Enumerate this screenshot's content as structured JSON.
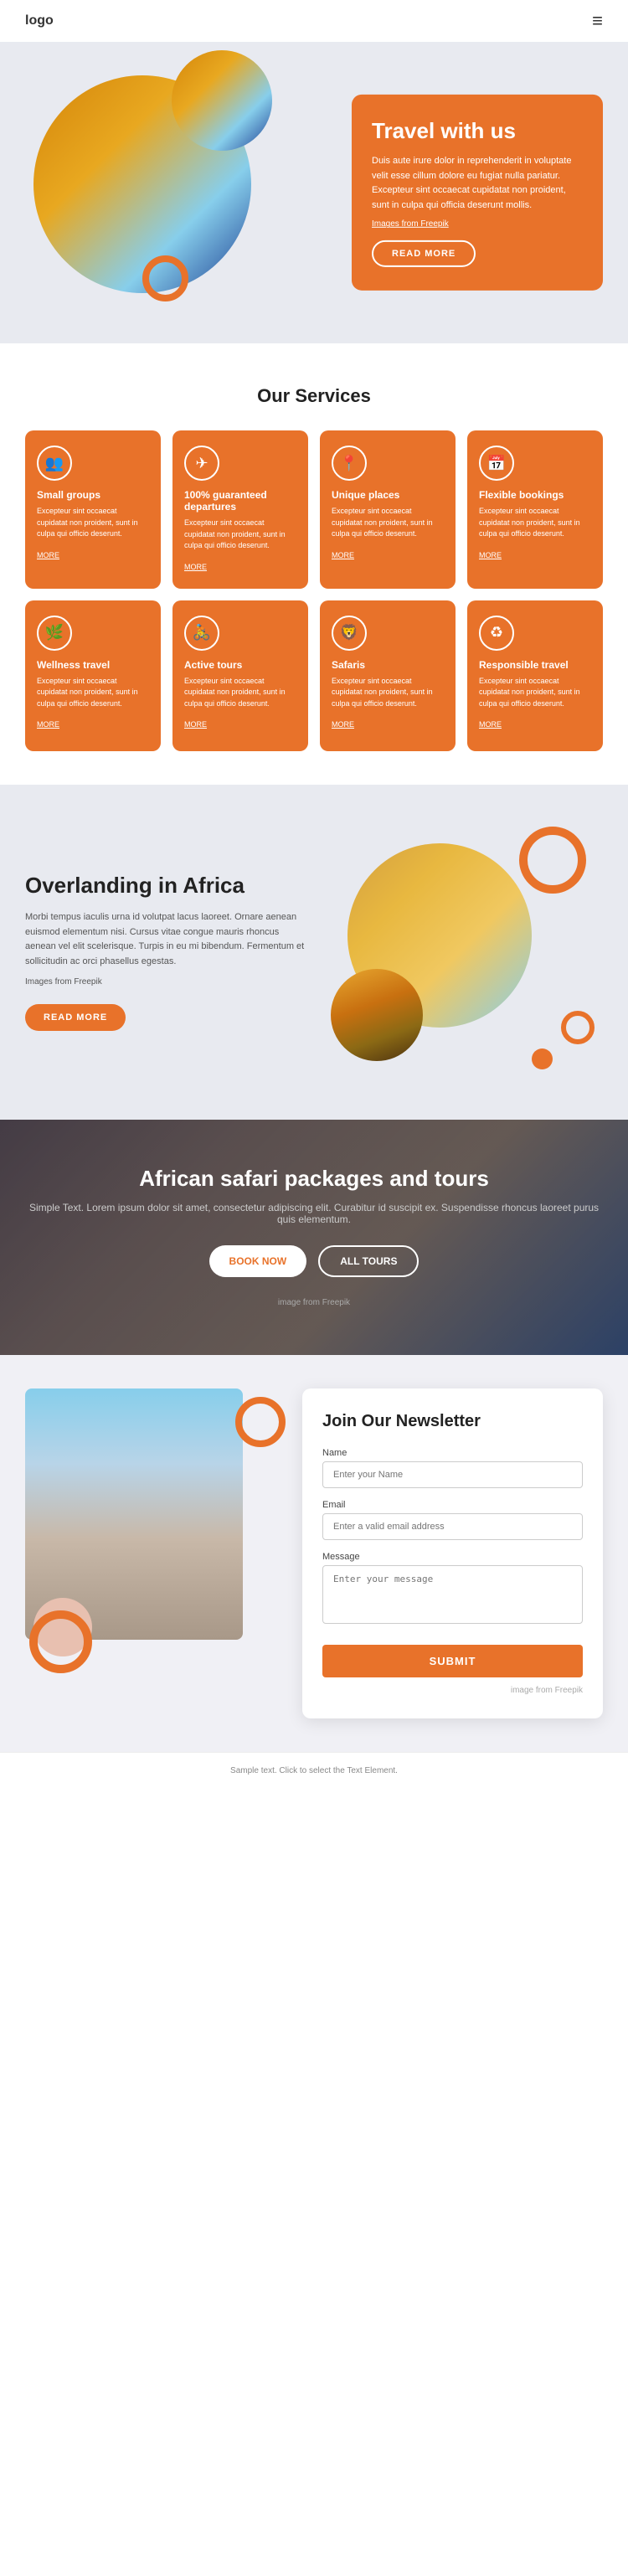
{
  "nav": {
    "logo": "logo",
    "hamburger_icon": "≡"
  },
  "hero": {
    "title": "Travel with us",
    "body": "Duis aute irure dolor in reprehenderit in voluptate velit esse cillum dolore eu fugiat nulla pariatur. Excepteur sint occaecat cupidatat non proident, sunt in culpa qui officia deserunt mollis.",
    "img_credit": "Images from Freepik",
    "read_more_btn": "READ MORE"
  },
  "services": {
    "heading": "Our Services",
    "cards": [
      {
        "icon": "👥",
        "title": "Small groups",
        "body": "Excepteur sint occaecat cupidatat non proident, sunt in culpa qui officio deserunt.",
        "link": "MORE"
      },
      {
        "icon": "✈",
        "title": "100% guaranteed departures",
        "body": "Excepteur sint occaecat cupidatat non proident, sunt in culpa qui officio deserunt.",
        "link": "MORE"
      },
      {
        "icon": "📍",
        "title": "Unique places",
        "body": "Excepteur sint occaecat cupidatat non proident, sunt in culpa qui officio deserunt.",
        "link": "MORE"
      },
      {
        "icon": "📅",
        "title": "Flexible bookings",
        "body": "Excepteur sint occaecat cupidatat non proident, sunt in culpa qui officio deserunt.",
        "link": "MORE"
      },
      {
        "icon": "🌿",
        "title": "Wellness travel",
        "body": "Excepteur sint occaecat cupidatat non proident, sunt in culpa qui officio deserunt.",
        "link": "MORE"
      },
      {
        "icon": "🚴",
        "title": "Active tours",
        "body": "Excepteur sint occaecat cupidatat non proident, sunt in culpa qui officio deserunt.",
        "link": "MORE"
      },
      {
        "icon": "🦁",
        "title": "Safaris",
        "body": "Excepteur sint occaecat cupidatat non proident, sunt in culpa qui officio deserunt.",
        "link": "MORE"
      },
      {
        "icon": "♻",
        "title": "Responsible travel",
        "body": "Excepteur sint occaecat cupidatat non proident, sunt in culpa qui officio deserunt.",
        "link": "MORE"
      }
    ]
  },
  "overlanding": {
    "title": "Overlanding in Africa",
    "body": "Morbi tempus iaculis urna id volutpat lacus laoreet. Ornare aenean euismod elementum nisi. Cursus vitae congue mauris rhoncus aenean vel elit scelerisque. Turpis in eu mi bibendum. Fermentum et sollicitudin ac orci phasellus egestas.",
    "img_credit": "Images from Freepik",
    "read_more_btn": "READ MORE"
  },
  "safari": {
    "title": "African safari packages and tours",
    "body": "Simple Text. Lorem ipsum dolor sit amet, consectetur adipiscing elit. Curabitur id suscipit ex. Suspendisse rhoncus laoreet purus quis elementum.",
    "book_now_btn": "BOOK NOW",
    "all_tours_btn": "ALL TOURS",
    "img_credit": "image from Freepik"
  },
  "newsletter": {
    "title": "Join Our Newsletter",
    "name_label": "Name",
    "name_placeholder": "Enter your Name",
    "email_label": "Email",
    "email_placeholder": "Enter a valid email address",
    "message_label": "Message",
    "message_placeholder": "Enter your message",
    "submit_btn": "SUBMIT",
    "img_credit": "image from Freepik"
  },
  "footer": {
    "note": "Sample text. Click to select the Text Element."
  }
}
